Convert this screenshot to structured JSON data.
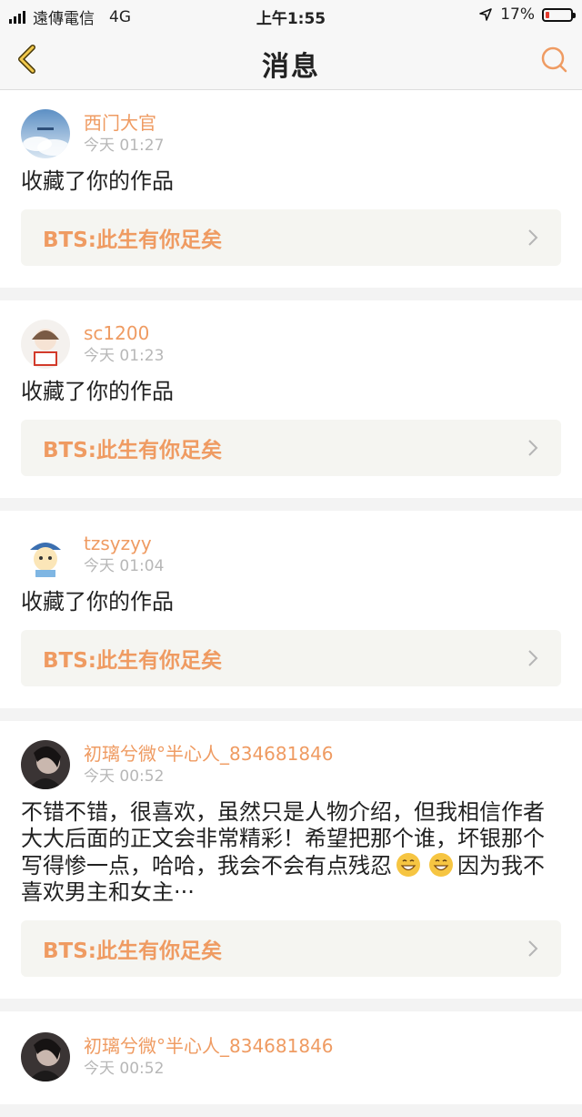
{
  "status_bar": {
    "carrier": "遠傳電信",
    "network": "4G",
    "time": "上午1:55",
    "battery": "17%",
    "battery_level": 0.17
  },
  "nav": {
    "title": "消息"
  },
  "messages": [
    {
      "username": "西门大官",
      "time": "今天 01:27",
      "text": "收藏了你的作品",
      "work_title": "BTS:此生有你足矣"
    },
    {
      "username": "sc1200",
      "time": "今天 01:23",
      "text": "收藏了你的作品",
      "work_title": "BTS:此生有你足矣"
    },
    {
      "username": "tzsyzyy",
      "time": "今天 01:04",
      "text": "收藏了你的作品",
      "work_title": "BTS:此生有你足矣"
    },
    {
      "username": "初璃兮微°半心人_834681846",
      "time": "今天 00:52",
      "text_line1": "不错不错，很喜欢，虽然只是人物介绍，但我相信作者大大后面的正文会非常精彩！希望把那个谁，坏银那个写得惨一点，哈哈，我会不会有点残忍",
      "text_line2": "因为我不喜欢男主和女主···",
      "work_title": "BTS:此生有你足矣"
    },
    {
      "username": "初璃兮微°半心人_834681846",
      "time": "今天 00:52"
    }
  ]
}
